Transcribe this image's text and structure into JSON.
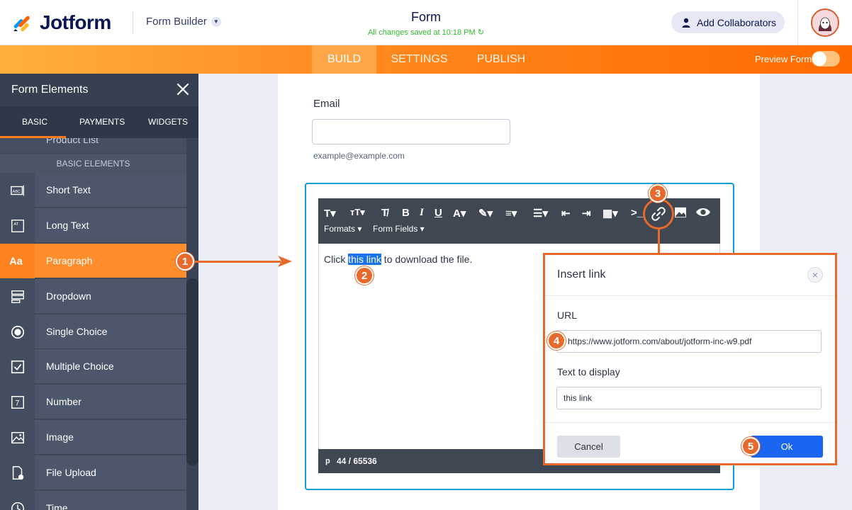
{
  "header": {
    "brand": "Jotform",
    "builder_menu": "Form Builder",
    "form_title": "Form",
    "save_status": "All changes saved at 10:18 PM",
    "collaborators_button": "Add Collaborators"
  },
  "nav": {
    "tabs": [
      "BUILD",
      "SETTINGS",
      "PUBLISH"
    ],
    "active_tab": "BUILD",
    "preview_label": "Preview Form",
    "preview_on": false
  },
  "sidebar": {
    "title": "Form Elements",
    "tabs": [
      "BASIC",
      "PAYMENTS",
      "WIDGETS"
    ],
    "partial_item": "Product List",
    "section": "BASIC ELEMENTS",
    "items": [
      {
        "label": "Short Text",
        "icon": "short-text-icon"
      },
      {
        "label": "Long Text",
        "icon": "long-text-icon"
      },
      {
        "label": "Paragraph",
        "icon": "paragraph-icon"
      },
      {
        "label": "Dropdown",
        "icon": "dropdown-icon"
      },
      {
        "label": "Single Choice",
        "icon": "radio-icon"
      },
      {
        "label": "Multiple Choice",
        "icon": "checkbox-icon"
      },
      {
        "label": "Number",
        "icon": "number-icon"
      },
      {
        "label": "Image",
        "icon": "image-icon"
      },
      {
        "label": "File Upload",
        "icon": "file-upload-icon"
      },
      {
        "label": "Time",
        "icon": "clock-icon"
      }
    ],
    "active_item": "Paragraph"
  },
  "form": {
    "email_label": "Email",
    "email_value": "",
    "email_sublabel": "example@example.com"
  },
  "editor": {
    "menus": [
      "Formats",
      "Form Fields"
    ],
    "text_before": "Click ",
    "selected_text": "this link",
    "text_after": " to download the file.",
    "status_tag": "p",
    "char_count": "44 / 65536"
  },
  "dialog": {
    "title": "Insert link",
    "url_label": "URL",
    "url_value": "https://www.jotform.com/about/jotform-inc-w9.pdf",
    "display_label": "Text to display",
    "display_value": "this link",
    "cancel": "Cancel",
    "ok": "Ok"
  },
  "annotations": [
    "1",
    "2",
    "3",
    "4",
    "5"
  ],
  "colors": {
    "accent_orange": "#ff7b1c",
    "annotation": "#e8692c",
    "ok_blue": "#1a66f0",
    "sidebar_bg": "#3f4a5c"
  }
}
